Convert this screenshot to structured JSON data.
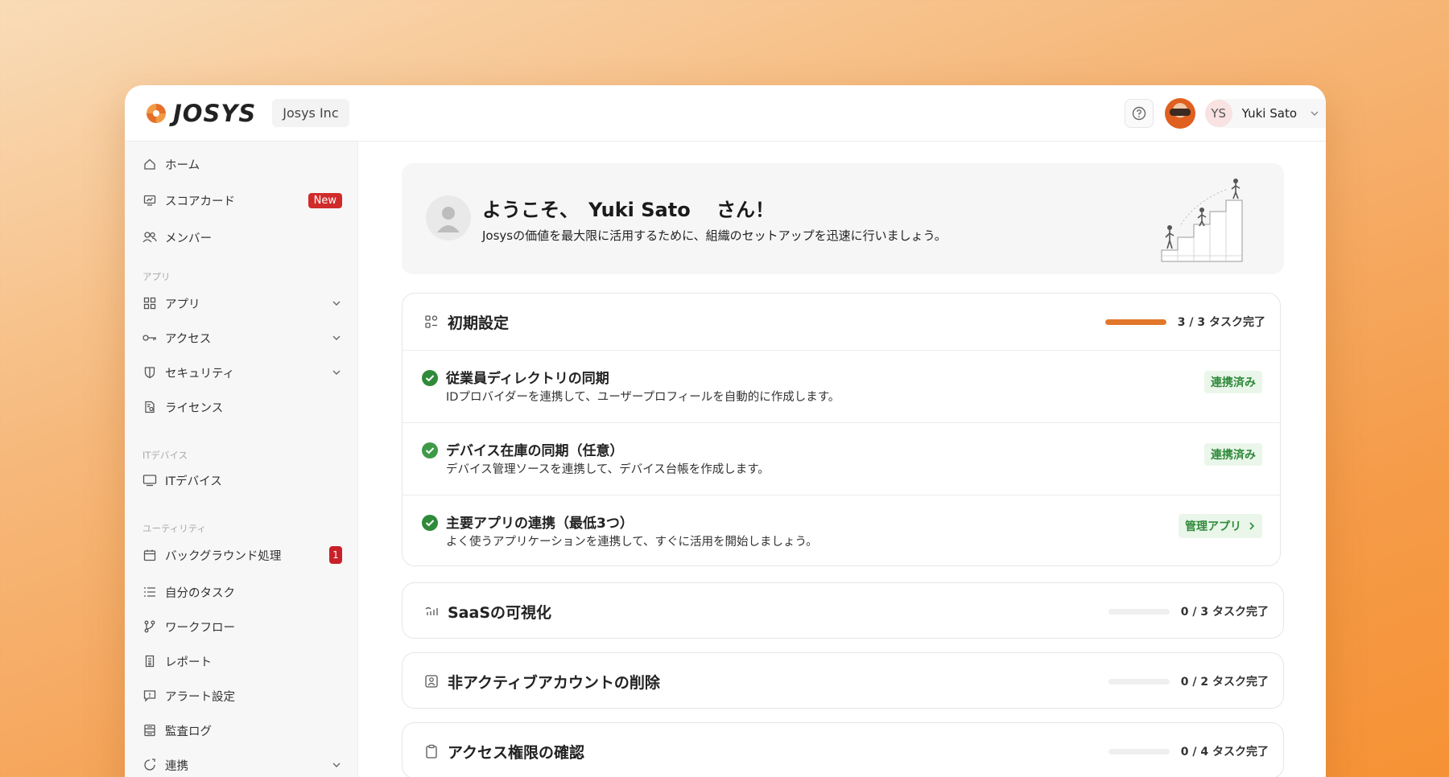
{
  "header": {
    "logo_text": "JOSYS",
    "org_name": "Josys Inc",
    "user_initials": "YS",
    "user_name": "Yuki Sato"
  },
  "sidebar": {
    "home": "ホーム",
    "scorecard": "スコアカード",
    "scorecard_badge": "New",
    "members": "メンバー",
    "section_apps": "アプリ",
    "apps": "アプリ",
    "access": "アクセス",
    "security": "セキュリティ",
    "license": "ライセンス",
    "section_it_devices": "ITデバイス",
    "it_devices": "ITデバイス",
    "section_utility": "ユーティリティ",
    "background_jobs": "バックグラウンド処理",
    "background_jobs_count": "1",
    "my_tasks": "自分のタスク",
    "workflow": "ワークフロー",
    "reports": "レポート",
    "alert_settings": "アラート設定",
    "audit_log": "監査ログ",
    "integrations": "連携"
  },
  "welcome": {
    "title": "ようこそ、　Yuki Sato　 さん！",
    "subtitle": "Josysの価値を最大限に活用するために、組織のセットアップを迅速に行いましょう。"
  },
  "initial_setup": {
    "title": "初期設定",
    "progress_text": "3 / 3 タスク完了",
    "progress": 1.0,
    "tasks": [
      {
        "title": "従業員ディレクトリの同期",
        "desc": "IDプロバイダーを連携して、ユーザープロフィールを自動的に作成します。",
        "status": "連携済み"
      },
      {
        "title": "デバイス在庫の同期（任意）",
        "desc": "デバイス管理ソースを連携して、デバイス台帳を作成します。",
        "status": "連携済み"
      },
      {
        "title": "主要アプリの連携（最低3つ）",
        "desc": "よく使うアプリケーションを連携して、すぐに活用を開始しましょう。",
        "action": "管理アプリ"
      }
    ]
  },
  "saas_visibility": {
    "title": "SaaSの可視化",
    "progress_text": "0 / 3 タスク完了",
    "progress": 0
  },
  "inactive_accounts": {
    "title": "非アクティブアカウントの削除",
    "progress_text": "0 / 2 タスク完了",
    "progress": 0
  },
  "access_review": {
    "title": "アクセス権限の確認",
    "progress_text": "0 / 4 タスク完了",
    "progress": 0
  },
  "colors": {
    "accent": "#e2762b",
    "success": "#2f8a3a",
    "badge_red": "#d02b2b"
  }
}
